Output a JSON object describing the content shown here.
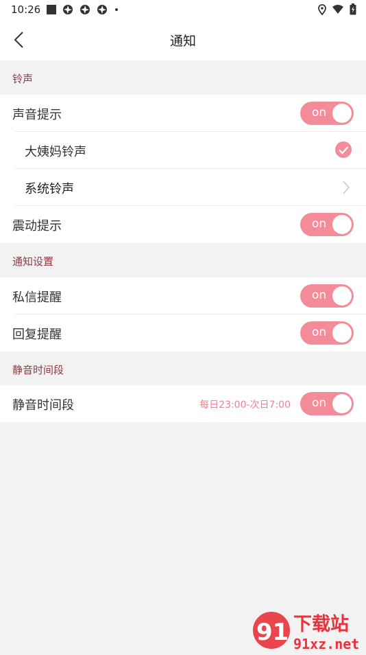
{
  "status_bar": {
    "time": "10:26",
    "icons": [
      "stop-square-icon",
      "aperture-icon",
      "aperture-icon",
      "aperture-icon",
      "notification-dot",
      "location-icon",
      "wifi-icon",
      "battery-icon"
    ]
  },
  "header": {
    "title": "通知",
    "back_icon": "chevron-left-icon"
  },
  "sections": {
    "ringtone": {
      "title": "铃声",
      "sound_alert": {
        "label": "声音提示",
        "toggle": "on"
      },
      "aunt_ringtone": {
        "label": "大姨妈铃声",
        "selected": true
      },
      "system_ringtone": {
        "label": "系统铃声"
      },
      "vibrate_alert": {
        "label": "震动提示",
        "toggle": "on"
      }
    },
    "notification_settings": {
      "title": "通知设置",
      "private_message": {
        "label": "私信提醒",
        "toggle": "on"
      },
      "reply": {
        "label": "回复提醒",
        "toggle": "on"
      }
    },
    "quiet_hours": {
      "title": "静音时间段",
      "row": {
        "label": "静音时间段",
        "value": "每日23:00-次日7:00",
        "toggle": "on"
      }
    }
  },
  "watermark": {
    "logo_text": "91",
    "text_top": "下载站",
    "text_bottom": "91xz.net"
  },
  "colors": {
    "accent": "#f48b98",
    "section_title": "#8b3c44",
    "background": "#f2f2f2",
    "watermark_red": "#e8323c"
  }
}
